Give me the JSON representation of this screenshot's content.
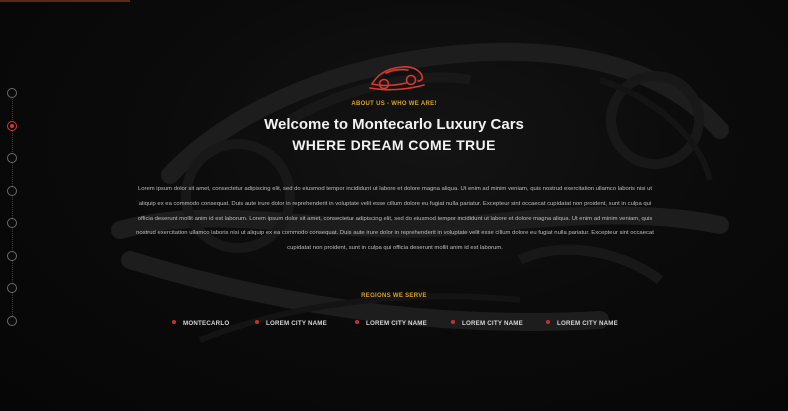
{
  "about": {
    "eyebrow": "ABOUT US - WHO WE ARE!",
    "title": "Welcome to Montecarlo Luxury Cars",
    "subtitle": "WHERE DREAM COME TRUE",
    "body": "Lorem ipsum dolor sit amet, consectetur adipiscing elit, sed do eiusmod tempor incididunt ut labore et dolore magna aliqua. Ut enim ad minim veniam, quis nostrud exercitation ullamco laboris nisi ut aliquip ex ea commodo consequat. Duis aute irure dolor in reprehenderit in voluptate velit esse cillum dolore eu fugiat nulla pariatur. Excepteur sint occaecat cupidatat non proident, sunt in culpa qui officia deserunt mollit anim id est laborum. Lorem ipsum dolor sit amet, consectetur adipiscing elit, sed do eiusmod tempor incididunt ut labore et dolore magna aliqua. Ut enim ad minim veniam, quis nostrud exercitation ullamco laboris nisi ut aliquip ex ea commodo consequat. Duis aute irure dolor in reprehenderit in voluptate velit esse cillum dolore eu fugiat nulla pariatur. Excepteur sint occaecat cupidatat non proident, sunt in culpa qui officia deserunt mollit anim id est laborum."
  },
  "regions": {
    "heading": "REGIONS WE SERVE",
    "items": [
      "MONTECARLO",
      "LOREM CITY NAME",
      "LOREM CITY NAME",
      "LOREM CITY NAME",
      "LOREM CITY NAME"
    ]
  },
  "nav": {
    "dots": 8,
    "active_index": 1
  },
  "icons": {
    "logo": "sports-car-icon",
    "bullet": "dot-bullet-icon",
    "nav_dot": "circle-nav-dot-icon"
  },
  "colors": {
    "accent_red": "#d9382b",
    "accent_gold": "#d9a321",
    "background": "#070707",
    "heading_text": "#f2f2f2",
    "body_text": "#bdbdbd"
  }
}
